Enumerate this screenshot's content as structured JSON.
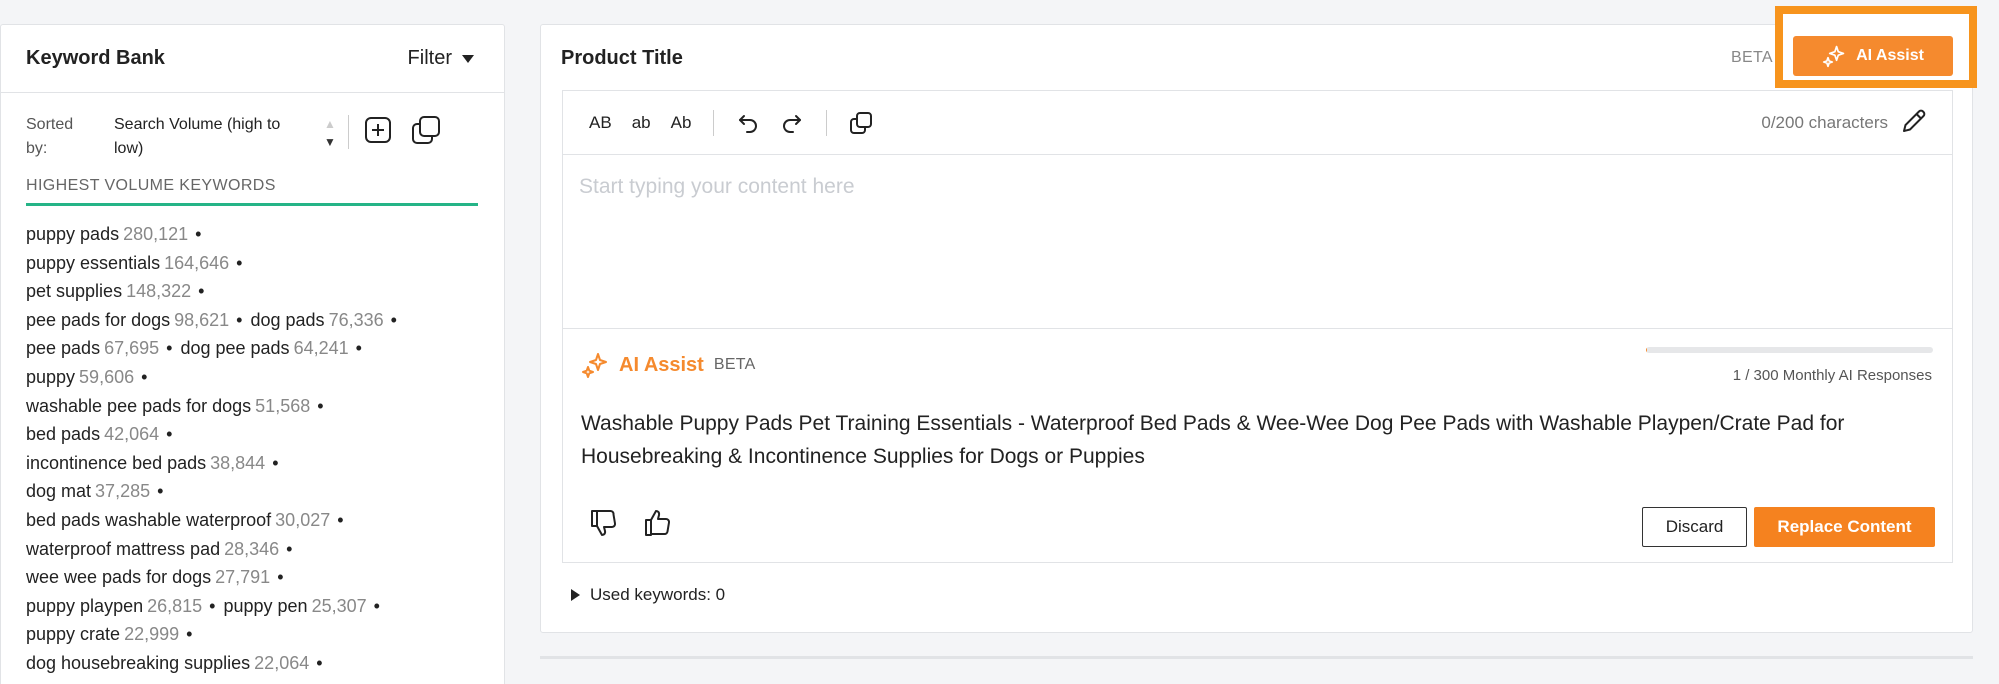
{
  "keyword_bank": {
    "title": "Keyword Bank",
    "filter_label": "Filter",
    "sorted_by_label": "Sorted by:",
    "sort_value": "Search Volume (high to low)",
    "highest_volume_title": "HIGHEST VOLUME KEYWORDS",
    "keyword_lines": [
      [
        {
          "term": "puppy pads",
          "volume": "280,121"
        }
      ],
      [
        {
          "term": "puppy essentials",
          "volume": "164,646"
        }
      ],
      [
        {
          "term": "pet supplies",
          "volume": "148,322"
        }
      ],
      [
        {
          "term": "pee pads for dogs",
          "volume": "98,621"
        },
        {
          "term": "dog pads",
          "volume": "76,336"
        }
      ],
      [
        {
          "term": "pee pads",
          "volume": "67,695"
        },
        {
          "term": "dog pee pads",
          "volume": "64,241"
        }
      ],
      [
        {
          "term": "puppy",
          "volume": "59,606"
        }
      ],
      [
        {
          "term": "washable pee pads for dogs",
          "volume": "51,568"
        }
      ],
      [
        {
          "term": "bed pads",
          "volume": "42,064"
        }
      ],
      [
        {
          "term": "incontinence bed pads",
          "volume": "38,844"
        }
      ],
      [
        {
          "term": "dog mat",
          "volume": "37,285"
        }
      ],
      [
        {
          "term": "bed pads washable waterproof",
          "volume": "30,027"
        }
      ],
      [
        {
          "term": "waterproof mattress pad",
          "volume": "28,346"
        }
      ],
      [
        {
          "term": "wee wee pads for dogs",
          "volume": "27,791"
        }
      ],
      [
        {
          "term": "puppy playpen",
          "volume": "26,815"
        },
        {
          "term": "puppy pen",
          "volume": "25,307"
        }
      ],
      [
        {
          "term": "puppy crate",
          "volume": "22,999"
        }
      ],
      [
        {
          "term": "dog housebreaking supplies",
          "volume": "22,064"
        }
      ]
    ]
  },
  "product_title": {
    "title": "Product Title",
    "beta_label": "BETA",
    "ai_assist_button": "AI Assist",
    "toolbar": {
      "uppercase": "AB",
      "lowercase": "ab",
      "titlecase": "Ab",
      "char_count": "0/200 characters"
    },
    "placeholder": "Start typing your content here",
    "ai_panel": {
      "label": "AI Assist",
      "beta": "BETA",
      "responses": "1 / 300 Monthly AI Responses",
      "progress_fraction": 0.0033,
      "suggestion": "Washable Puppy Pads Pet Training Essentials - Waterproof Bed Pads & Wee-Wee Dog Pee Pads with Washable Playpen/Crate Pad for Housebreaking & Incontinence Supplies for Dogs or Puppies",
      "discard_label": "Discard",
      "replace_label": "Replace Content"
    },
    "used_keywords": "Used keywords: 0"
  },
  "colors": {
    "accent_orange": "#f58a2e",
    "highlight_orange": "#f7941d",
    "green_underline": "#25b487"
  }
}
